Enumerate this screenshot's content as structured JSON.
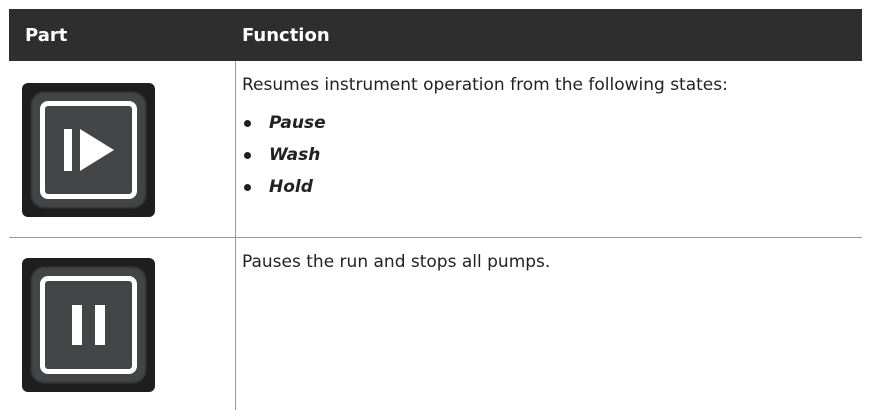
{
  "table": {
    "headers": {
      "part": "Part",
      "function": "Function"
    },
    "rows": [
      {
        "icon": "resume-play-icon",
        "description": "Resumes instrument operation from the following states:",
        "states": [
          "Pause",
          "Wash",
          "Hold"
        ]
      },
      {
        "icon": "pause-icon",
        "description": "Pauses the run and stops all pumps.",
        "states": []
      }
    ]
  },
  "colors": {
    "header_bg": "#2e2e2e",
    "button_face": "#444547",
    "button_rim": "#1e1e1e"
  }
}
